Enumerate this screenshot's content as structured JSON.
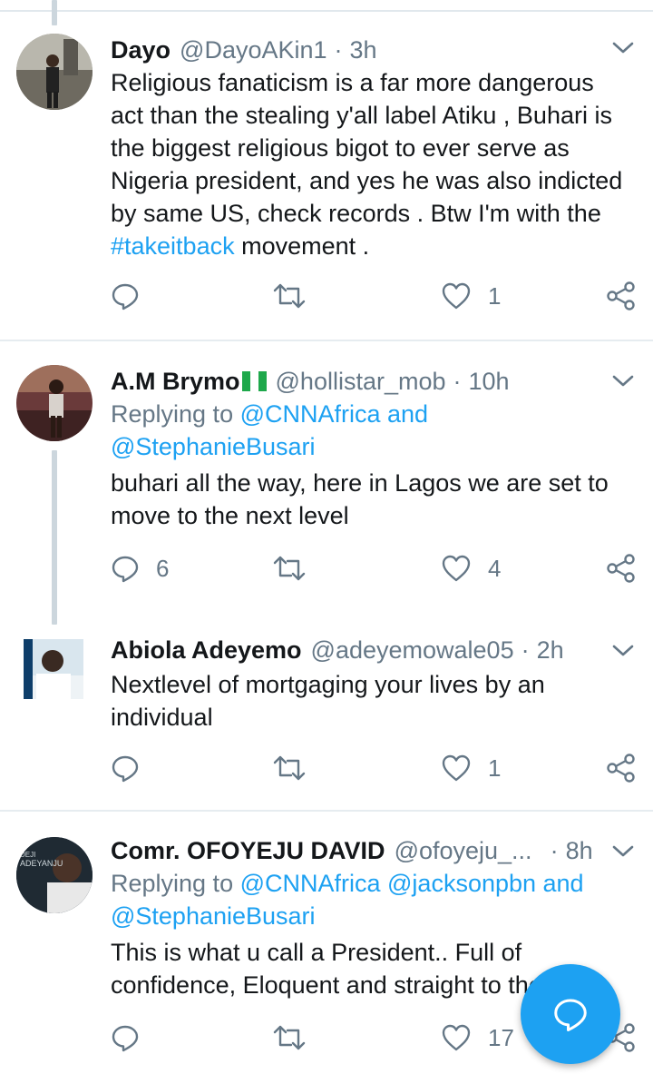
{
  "colors": {
    "accent": "#1da1f2",
    "muted": "#657786",
    "text": "#14171a",
    "divider": "#e6ecf0"
  },
  "tweets": [
    {
      "name": "Dayo",
      "handle": "@DayoAKin1",
      "separator": "·",
      "time": "3h",
      "text_lines": [
        "Religious fanaticism is a far more dangerous",
        "act than the stealing y'all label  Atiku , Buhari is",
        "the biggest religious bigot to ever serve as",
        "Nigeria president, and yes he was also indicted",
        "by same US, check records . Btw I'm with the"
      ],
      "hashtag": "#takeitback",
      "text_tail": " movement .",
      "replies": "",
      "retweets": "",
      "likes": "1"
    },
    {
      "name": "A.M Brymo",
      "handle": "@hollistar_mob",
      "separator": "·",
      "time": "10h",
      "replying_prefix": "Replying to ",
      "replying_line1": "@CNNAfrica and",
      "replying_line2": "@StephanieBusari",
      "text_lines": [
        "buhari all the way, here in Lagos we are set to",
        "move to the next level"
      ],
      "replies": "6",
      "retweets": "",
      "likes": "4"
    },
    {
      "name": "Abiola Adeyemo",
      "handle": "@adeyemowale05",
      "separator": "·",
      "time": "2h",
      "text_lines": [
        "Nextlevel of mortgaging your lives by an",
        "individual"
      ],
      "replies": "",
      "retweets": "",
      "likes": "1"
    },
    {
      "name": "Comr. OFOYEJU DAVID",
      "handle": "@ofoyeju_...",
      "separator": "·",
      "time": "8h",
      "avatar_text_1": "DEJI",
      "avatar_text_2": "ADEYANJU",
      "replying_prefix": "Replying to ",
      "replying_line1": "@CNNAfrica @jacksonpbn and",
      "replying_line2": "@StephanieBusari",
      "text_lines": [
        "This is what u call a President.. Full of",
        "confidence, Eloquent and straight to the point.."
      ],
      "replies": "",
      "retweets": "",
      "likes": "17"
    }
  ]
}
